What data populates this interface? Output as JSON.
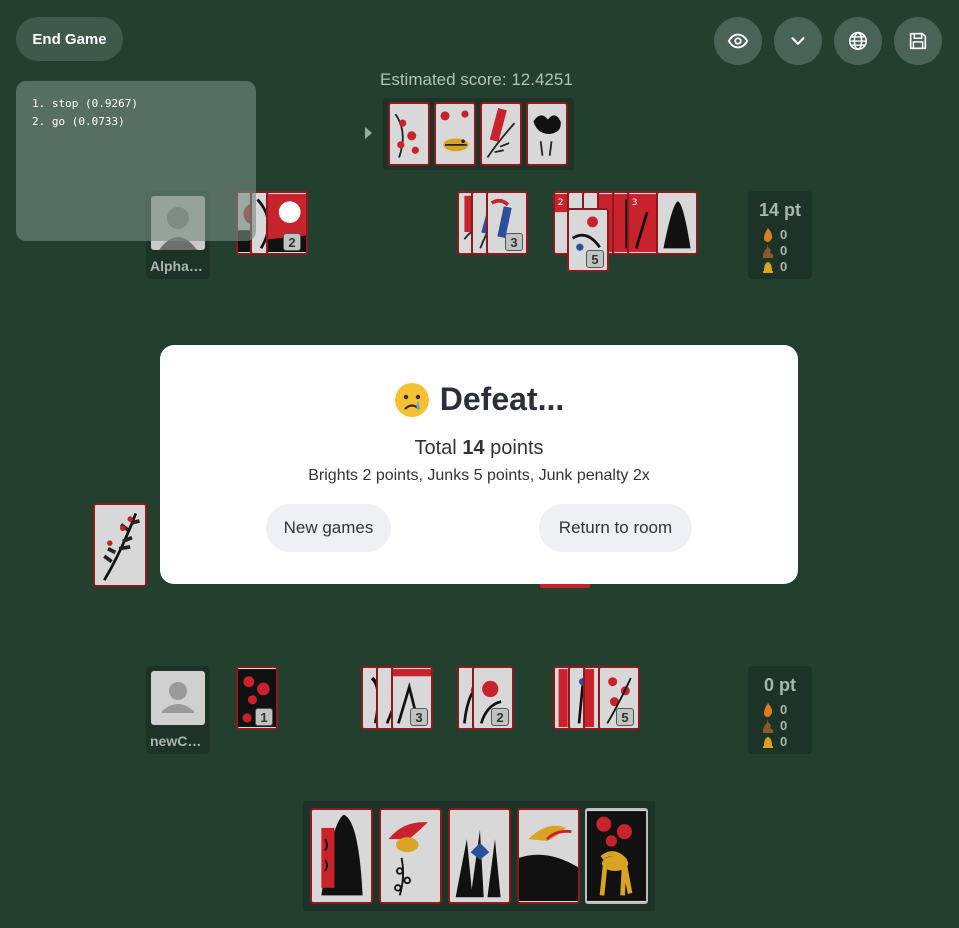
{
  "controls": {
    "end_game_label": "End Game",
    "icons": [
      "eye-icon",
      "chevron-down-icon",
      "globe-icon",
      "save-icon"
    ]
  },
  "estimate": {
    "label": "Estimated score: 12.4251"
  },
  "ai_suggestions": {
    "items": [
      "1. stop (0.9267)",
      "2. go (0.0733)"
    ]
  },
  "opponent": {
    "name": "Alpha…",
    "score": "14 pt",
    "stats": [
      {
        "icon": "fire-icon",
        "value": "0"
      },
      {
        "icon": "poop-icon",
        "value": "0"
      },
      {
        "icon": "bell-icon",
        "value": "0"
      }
    ],
    "capture_counts": [
      "2",
      "3",
      "5"
    ]
  },
  "player": {
    "name": "newC…",
    "score": "0 pt",
    "stats": [
      {
        "icon": "fire-icon",
        "value": "0"
      },
      {
        "icon": "poop-icon",
        "value": "0"
      },
      {
        "icon": "bell-icon",
        "value": "0"
      }
    ],
    "capture_counts": [
      "1",
      "3",
      "2",
      "5"
    ]
  },
  "modal": {
    "emoji": "crying-face-icon",
    "title": "Defeat...",
    "total_prefix": "Total",
    "total_value": "14",
    "total_suffix": "points",
    "breakdown": "Brights 2 points, Junks 5 points, Junk penalty 2x",
    "new_games_label": "New games",
    "return_label": "Return to room"
  },
  "colors": {
    "background": "#23402f",
    "card_border": "#8a1a1e",
    "card_red": "#c8232c",
    "panel": "#1d3327"
  }
}
